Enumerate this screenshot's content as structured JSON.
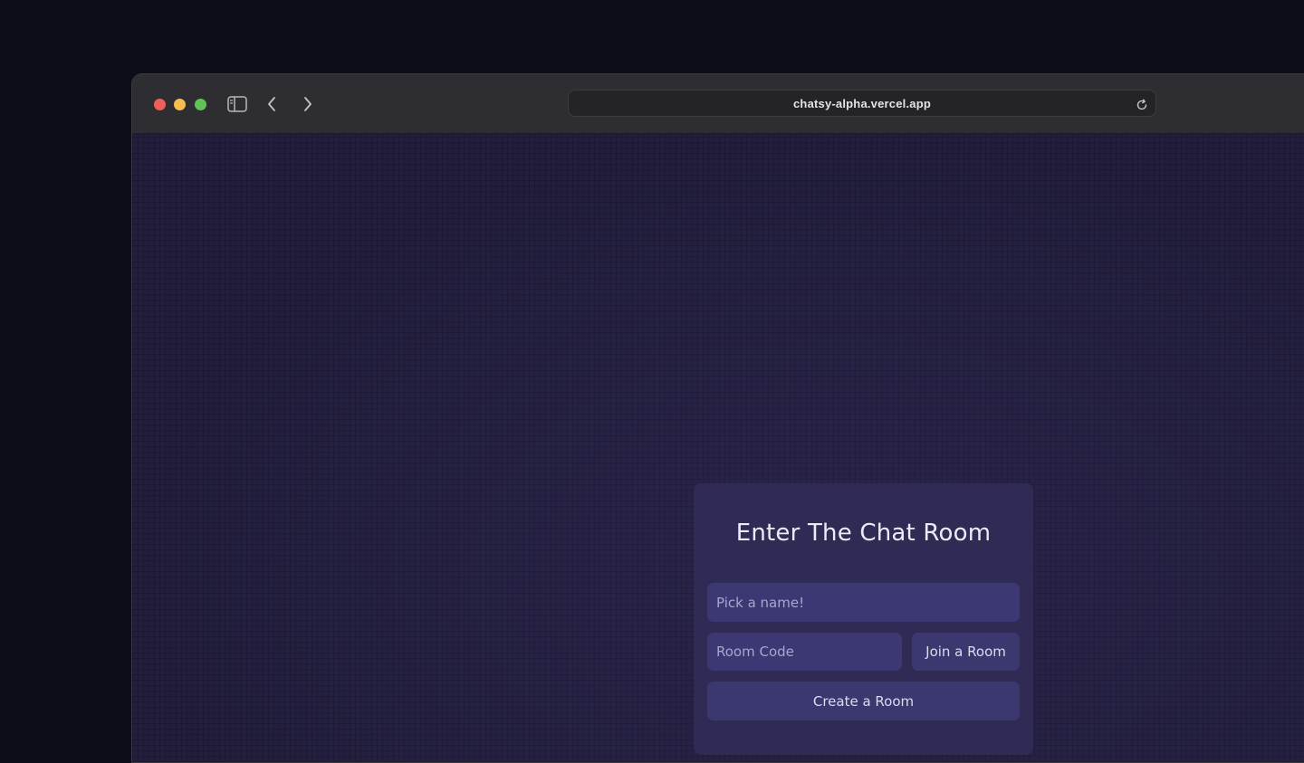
{
  "browser": {
    "url": "chatsy-alpha.vercel.app",
    "traffic_colors": {
      "close": "#ee5f58",
      "minimize": "#f5be4f",
      "maximize": "#5fc454"
    },
    "icons": [
      "sidebar-icon",
      "chevron-left-icon",
      "chevron-right-icon",
      "reload-icon"
    ]
  },
  "card": {
    "title": "Enter The Chat Room",
    "name_placeholder": "Pick a name!",
    "room_code_placeholder": "Room Code",
    "join_label": "Join a Room",
    "create_label": "Create a Room"
  },
  "colors": {
    "page_background": "#25213f",
    "card_background": "#2f2b55",
    "field_background": "#3b3874"
  }
}
